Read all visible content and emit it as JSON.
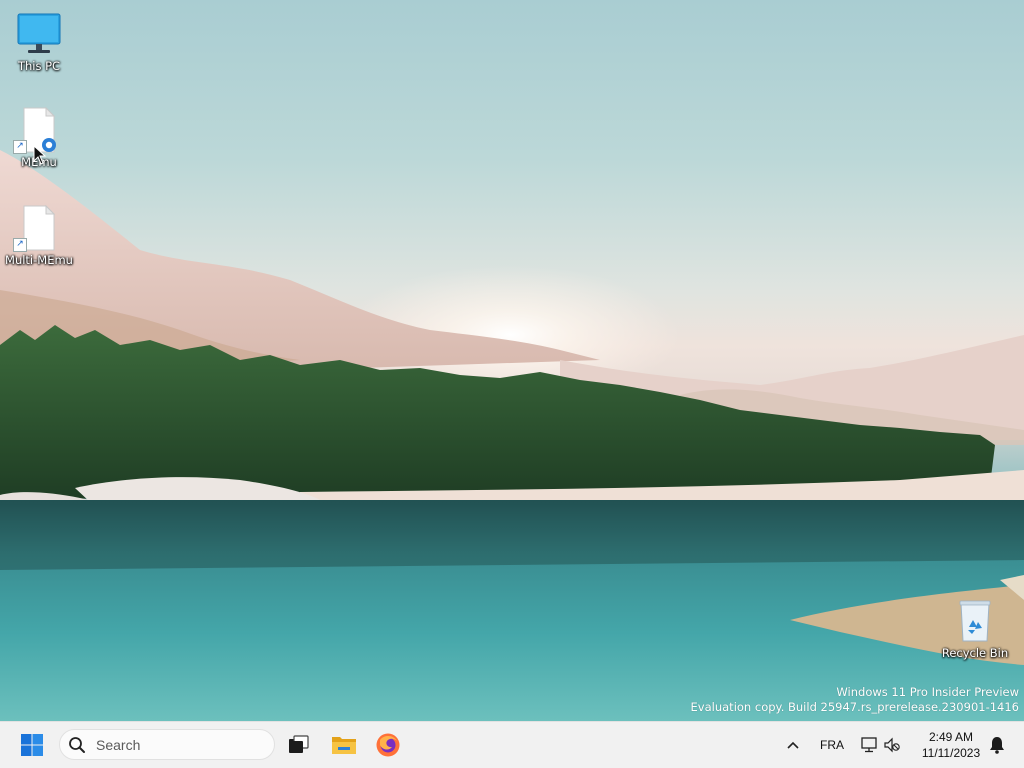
{
  "desktop": {
    "icons": [
      {
        "label": "This PC",
        "icon": "monitor-icon"
      },
      {
        "label": "MEmu",
        "icon": "memu-file-icon"
      },
      {
        "label": "Multi-MEmu",
        "icon": "multi-memu-file-icon"
      },
      {
        "label": "Recycle Bin",
        "icon": "recycle-bin-icon"
      }
    ],
    "watermark": {
      "line1": "Windows 11 Pro Insider Preview",
      "line2": "Evaluation copy. Build 25947.rs_prerelease.230901-1416"
    }
  },
  "taskbar": {
    "search_placeholder": "Search",
    "pinned": [
      "start-icon",
      "task-view-icon",
      "file-explorer-icon",
      "firefox-icon"
    ],
    "tray": {
      "language": "FRA",
      "time": "2:49 AM",
      "date": "11/11/2023"
    }
  },
  "colors": {
    "start_blue": "#1a73d9",
    "taskbar_bg": "#f1f1f1",
    "folder_yellow": "#f6c343"
  }
}
